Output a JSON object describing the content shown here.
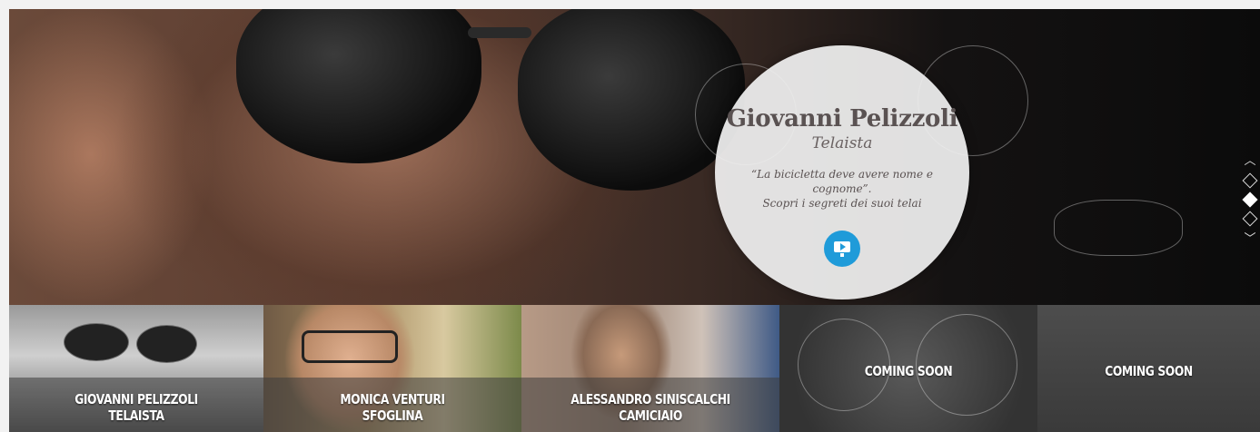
{
  "hero": {
    "name": "Giovanni Pelizzoli",
    "role": "Telaista",
    "quote_line1": "“La bicicletta deve avere nome e",
    "quote_line2": "cognome”.",
    "quote_line3": "Scopri i segreti dei suoi telai",
    "play_icon": "video-screen-play-icon",
    "colors": {
      "circle_bg": "#f0f0f0",
      "play_button": "#1f9bd9"
    }
  },
  "slider_nav": {
    "up_arrow": "︿",
    "down_arrow": "﹀",
    "dots": 3,
    "active_dot": 2
  },
  "tiles": [
    {
      "line1": "GIOVANNI PELIZZOLI",
      "line2": "TELAISTA"
    },
    {
      "line1": "MONICA VENTURI",
      "line2": "SFOGLINA"
    },
    {
      "line1": "ALESSANDRO SINISCALCHI",
      "line2": "CAMICIAIO"
    },
    {
      "line1": "COMING SOON",
      "line2": ""
    },
    {
      "line1": "COMING SOON",
      "line2": ""
    }
  ]
}
